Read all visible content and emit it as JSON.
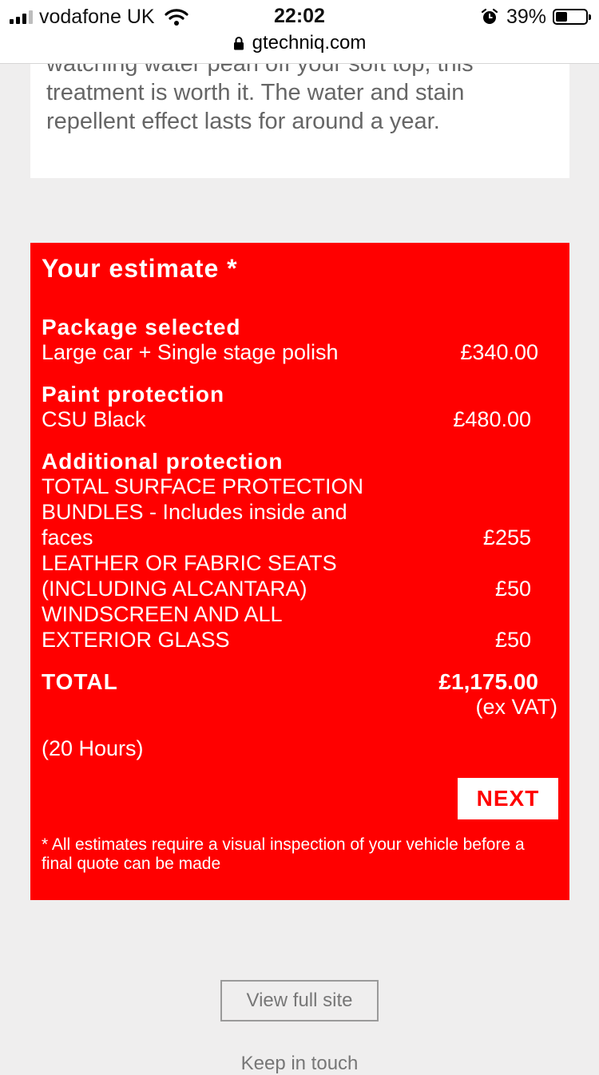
{
  "status_bar": {
    "carrier": "vodafone UK",
    "time": "22:02",
    "battery_percent": "39%",
    "battery_level": 0.39,
    "icons": [
      "signal-icon",
      "wifi-icon",
      "alarm-icon",
      "battery-icon",
      "lock-icon"
    ]
  },
  "browser": {
    "url": "gtechniq.com"
  },
  "intro": {
    "text": "watching water pearl off your soft top, this treatment is worth it. The water and stain repellent effect lasts for around a year."
  },
  "estimate": {
    "title": "Your estimate *",
    "package": {
      "heading": "Package selected",
      "item": "Large car + Single stage polish",
      "price": "£340.00"
    },
    "paint": {
      "heading": "Paint protection",
      "item": "CSU Black",
      "price": "£480.00"
    },
    "additional": {
      "heading": "Additional protection",
      "items": [
        {
          "lines": [
            "TOTAL SURFACE PROTECTION",
            "BUNDLES - Includes inside and",
            "faces"
          ],
          "price": "£255"
        },
        {
          "lines": [
            "LEATHER OR FABRIC SEATS",
            "(INCLUDING ALCANTARA)"
          ],
          "price": "£50"
        },
        {
          "lines": [
            "WINDSCREEN AND ALL",
            "EXTERIOR GLASS"
          ],
          "price": "£50"
        }
      ]
    },
    "total_label": "TOTAL",
    "total_value": "£1,175.00",
    "vat_note": "(ex VAT)",
    "hours": "(20 Hours)",
    "next_label": "NEXT",
    "disclaimer": "* All estimates require a visual inspection of your vehicle before a final quote can be made"
  },
  "footer": {
    "full_site_label": "View full site",
    "keep_in_touch": "Keep in touch"
  },
  "colors": {
    "accent": "#ff0000",
    "background": "#efeeee",
    "card": "#ffffff"
  }
}
